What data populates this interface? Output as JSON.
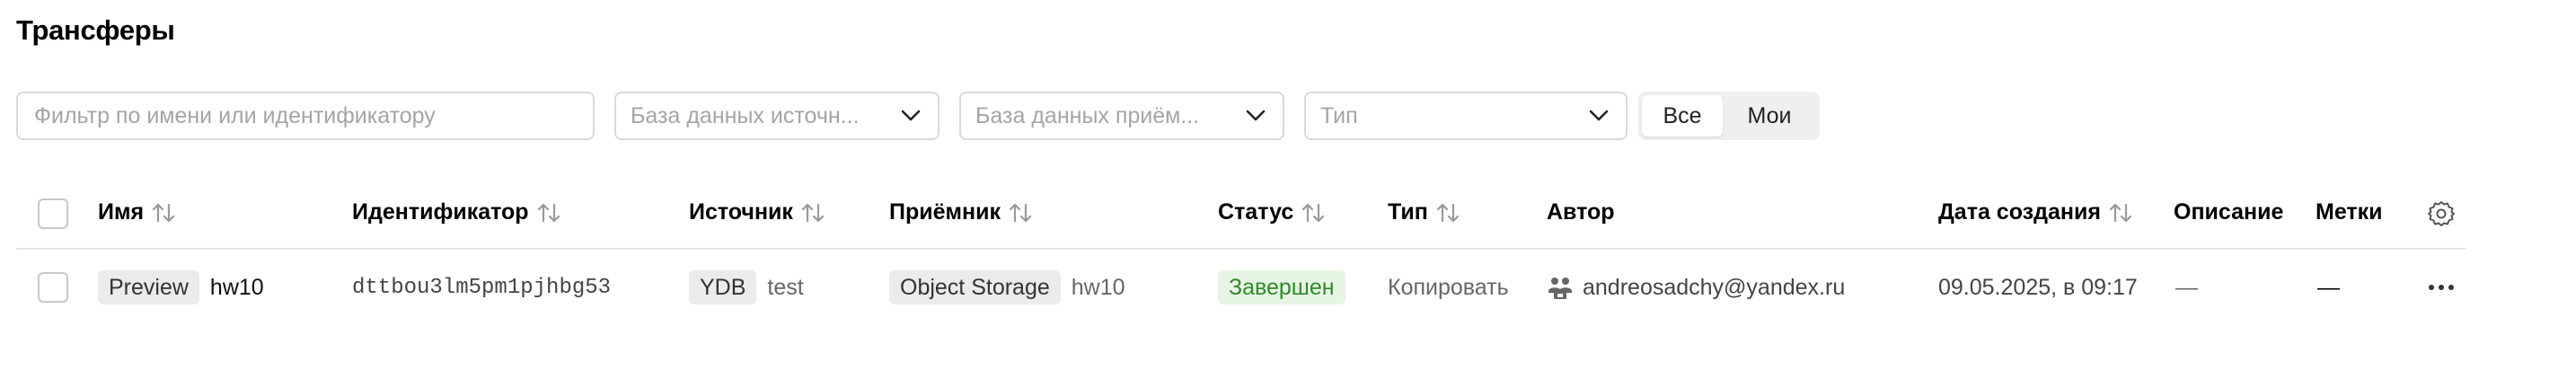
{
  "page": {
    "title": "Трансферы"
  },
  "filters": {
    "search_placeholder": "Фильтр по имени или идентификатору",
    "source_db_placeholder": "База данных источн...",
    "target_db_placeholder": "База данных приём...",
    "type_placeholder": "Тип",
    "segment": {
      "all_label": "Все",
      "mine_label": "Мои",
      "selected": "Все"
    }
  },
  "table": {
    "columns": {
      "name": "Имя",
      "id": "Идентификатор",
      "source": "Источник",
      "target": "Приёмник",
      "status": "Статус",
      "type": "Тип",
      "author": "Автор",
      "created": "Дата создания",
      "description": "Описание",
      "labels": "Метки"
    },
    "rows": [
      {
        "name_tag": "Preview",
        "name": "hw10",
        "id": "dttbou3lm5pm1pjhbg53",
        "source_tag": "YDB",
        "source_name": "test",
        "target_tag": "Object Storage",
        "target_name": "hw10",
        "status": "Завершен",
        "type": "Копировать",
        "author": "andreosadchy@yandex.ru",
        "created": "09.05.2025, в 09:17",
        "description": "—",
        "labels": "—"
      }
    ]
  },
  "colors": {
    "status_success_bg": "#e7f5e4",
    "status_success_text": "#2f8a2a",
    "tag_bg": "#ebebeb"
  }
}
